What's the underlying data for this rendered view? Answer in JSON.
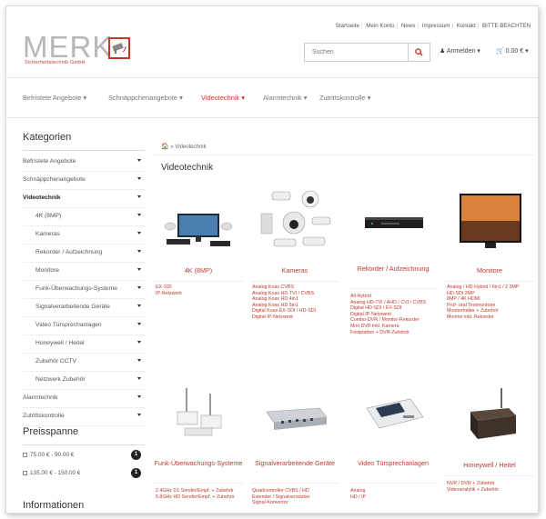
{
  "top_links": [
    "Startseite",
    "Mein Konto",
    "News",
    "Impressum",
    "Kontakt",
    "BITTE BEACHTEN"
  ],
  "logo": {
    "word": "MERK",
    "sub": "Sicherheitstechnik GmbH"
  },
  "search": {
    "placeholder": "Suchen"
  },
  "account": {
    "label": "Anmelden ▾"
  },
  "cart": {
    "label": "0.00 € ▾"
  },
  "nav": [
    {
      "label": "Befristete Angebote ▾"
    },
    {
      "label": "Schnäppchenangebote ▾"
    },
    {
      "label": "Videotechnik ▾"
    },
    {
      "label": "Alarmtechnik ▾"
    },
    {
      "label": "Zutrittskontrolle ▾"
    }
  ],
  "sidebar": {
    "title": "Kategorien",
    "categories": [
      {
        "label": "Befristete Angebote"
      },
      {
        "label": "Schnäppchenangebote"
      },
      {
        "label": "Videotechnik"
      },
      {
        "label": "4K (8MP)"
      },
      {
        "label": "Kameras"
      },
      {
        "label": "Rekorder / Aufzeichnung"
      },
      {
        "label": "Monitore"
      },
      {
        "label": "Funk-Überwachungs-Systeme"
      },
      {
        "label": "Signalverarbeitende Geräte"
      },
      {
        "label": "Video Türsprechanlagen"
      },
      {
        "label": "Honeywell / Heitel"
      },
      {
        "label": "Zubehör CCTV"
      },
      {
        "label": "Netzwerk Zubehör"
      },
      {
        "label": "Alarmtechnik"
      },
      {
        "label": "Zutrittskontrolle"
      }
    ],
    "price_title": "Preisspanne",
    "prices": [
      {
        "label": "75.00 € - 90.00 €",
        "count": "1"
      },
      {
        "label": "135.00 € - 150.00 €",
        "count": "1"
      }
    ],
    "info_title": "Informationen"
  },
  "breadcrumb": {
    "home": "🏠",
    "current": "» Videotechnik"
  },
  "content_title": "Videotechnik",
  "products": [
    {
      "name": "4K (8MP)",
      "subs": [
        "EX-SDI",
        "IP-Netzwerk"
      ]
    },
    {
      "name": "Kameras",
      "subs": [
        "Analog Koax CVBS",
        "Analog Koax HD-TVI / CVBS",
        "Analog Koax HD 4in1",
        "Analog Koax HD 5in1",
        "Digital Koax EX-SDI / HD-SDI",
        "Digital IP-Netzwerk"
      ]
    },
    {
      "name": "Rekorder / Aufzeichnung",
      "subs": [
        "All-Hybrid",
        "Analog HD-TVI / AHD / CVI / CVBS",
        "Digital HD-SDI / EX-SDI",
        "Digital IP-Netzwerk",
        "Combo-DVR / Monitor-Rekorder",
        "Mini-DVR inkl. Kamera",
        "Festplatten + DVR-Zubehör"
      ]
    },
    {
      "name": "Monitore",
      "subs": [
        "Analog / HD Hybrid / 6in1 / 2.3MP",
        "HD-SDI 2MP",
        "8MP / 4K HDMI",
        "Prüf- und Testmonitore",
        "Monitorhalter + Zubehör",
        "Monitor inkl. Rekorder"
      ]
    },
    {
      "name": "Funk-Überwachungs-Systeme",
      "subs": [
        "2.4GHz D1 Sender/Empf. + Zubehör",
        "5.8GHz HD Sender/Empf. + Zubehör"
      ]
    },
    {
      "name": "Signalverarbeitende Geräte",
      "subs": [
        "Quadcontroller CVBS / HD",
        "Extender / Signalverstärker",
        "Signal-Konvertor"
      ]
    },
    {
      "name": "Video Türsprechanlagen",
      "subs": [
        "Analog",
        "HD / IP"
      ]
    },
    {
      "name": "Honeywell / Heitel",
      "subs": [
        "NVR / DVR + Zubehör",
        "Videoanalytik + Zubehör"
      ]
    }
  ]
}
